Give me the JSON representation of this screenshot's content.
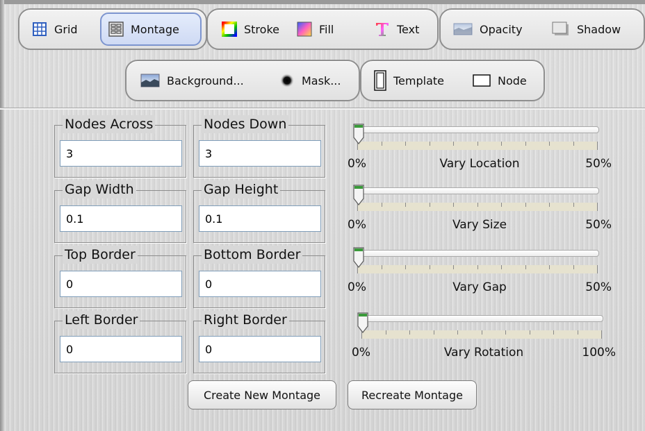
{
  "toolbar": {
    "row1": {
      "grid": "Grid",
      "montage": "Montage",
      "stroke": "Stroke",
      "fill": "Fill",
      "text": "Text",
      "opacity": "Opacity",
      "shadow": "Shadow"
    },
    "row2": {
      "background": "Background...",
      "mask": "Mask...",
      "template": "Template",
      "node": "Node"
    },
    "selected": "Montage"
  },
  "fields": {
    "nodes_across": {
      "label": "Nodes Across",
      "value": "3"
    },
    "nodes_down": {
      "label": "Nodes Down",
      "value": "3"
    },
    "gap_width": {
      "label": "Gap Width",
      "value": "0.1"
    },
    "gap_height": {
      "label": "Gap Height",
      "value": "0.1"
    },
    "top_border": {
      "label": "Top Border",
      "value": "0"
    },
    "bottom_border": {
      "label": "Bottom Border",
      "value": "0"
    },
    "left_border": {
      "label": "Left Border",
      "value": "0"
    },
    "right_border": {
      "label": "Right Border",
      "value": "0"
    }
  },
  "sliders": {
    "vary_location": {
      "title": "Vary Location",
      "min": "0%",
      "max": "50%",
      "value": 0
    },
    "vary_size": {
      "title": "Vary Size",
      "min": "0%",
      "max": "50%",
      "value": 0
    },
    "vary_gap": {
      "title": "Vary Gap",
      "min": "0%",
      "max": "50%",
      "value": 0
    },
    "vary_rotation": {
      "title": "Vary Rotation",
      "min": "0%",
      "max": "100%",
      "value": 0
    }
  },
  "buttons": {
    "create_new_montage": "Create New Montage",
    "recreate_montage": "Recreate Montage"
  },
  "colors": {
    "selected_border": "#7d95cf",
    "thumb_green": "#3a9a3a",
    "field_border": "#7f9db9"
  }
}
